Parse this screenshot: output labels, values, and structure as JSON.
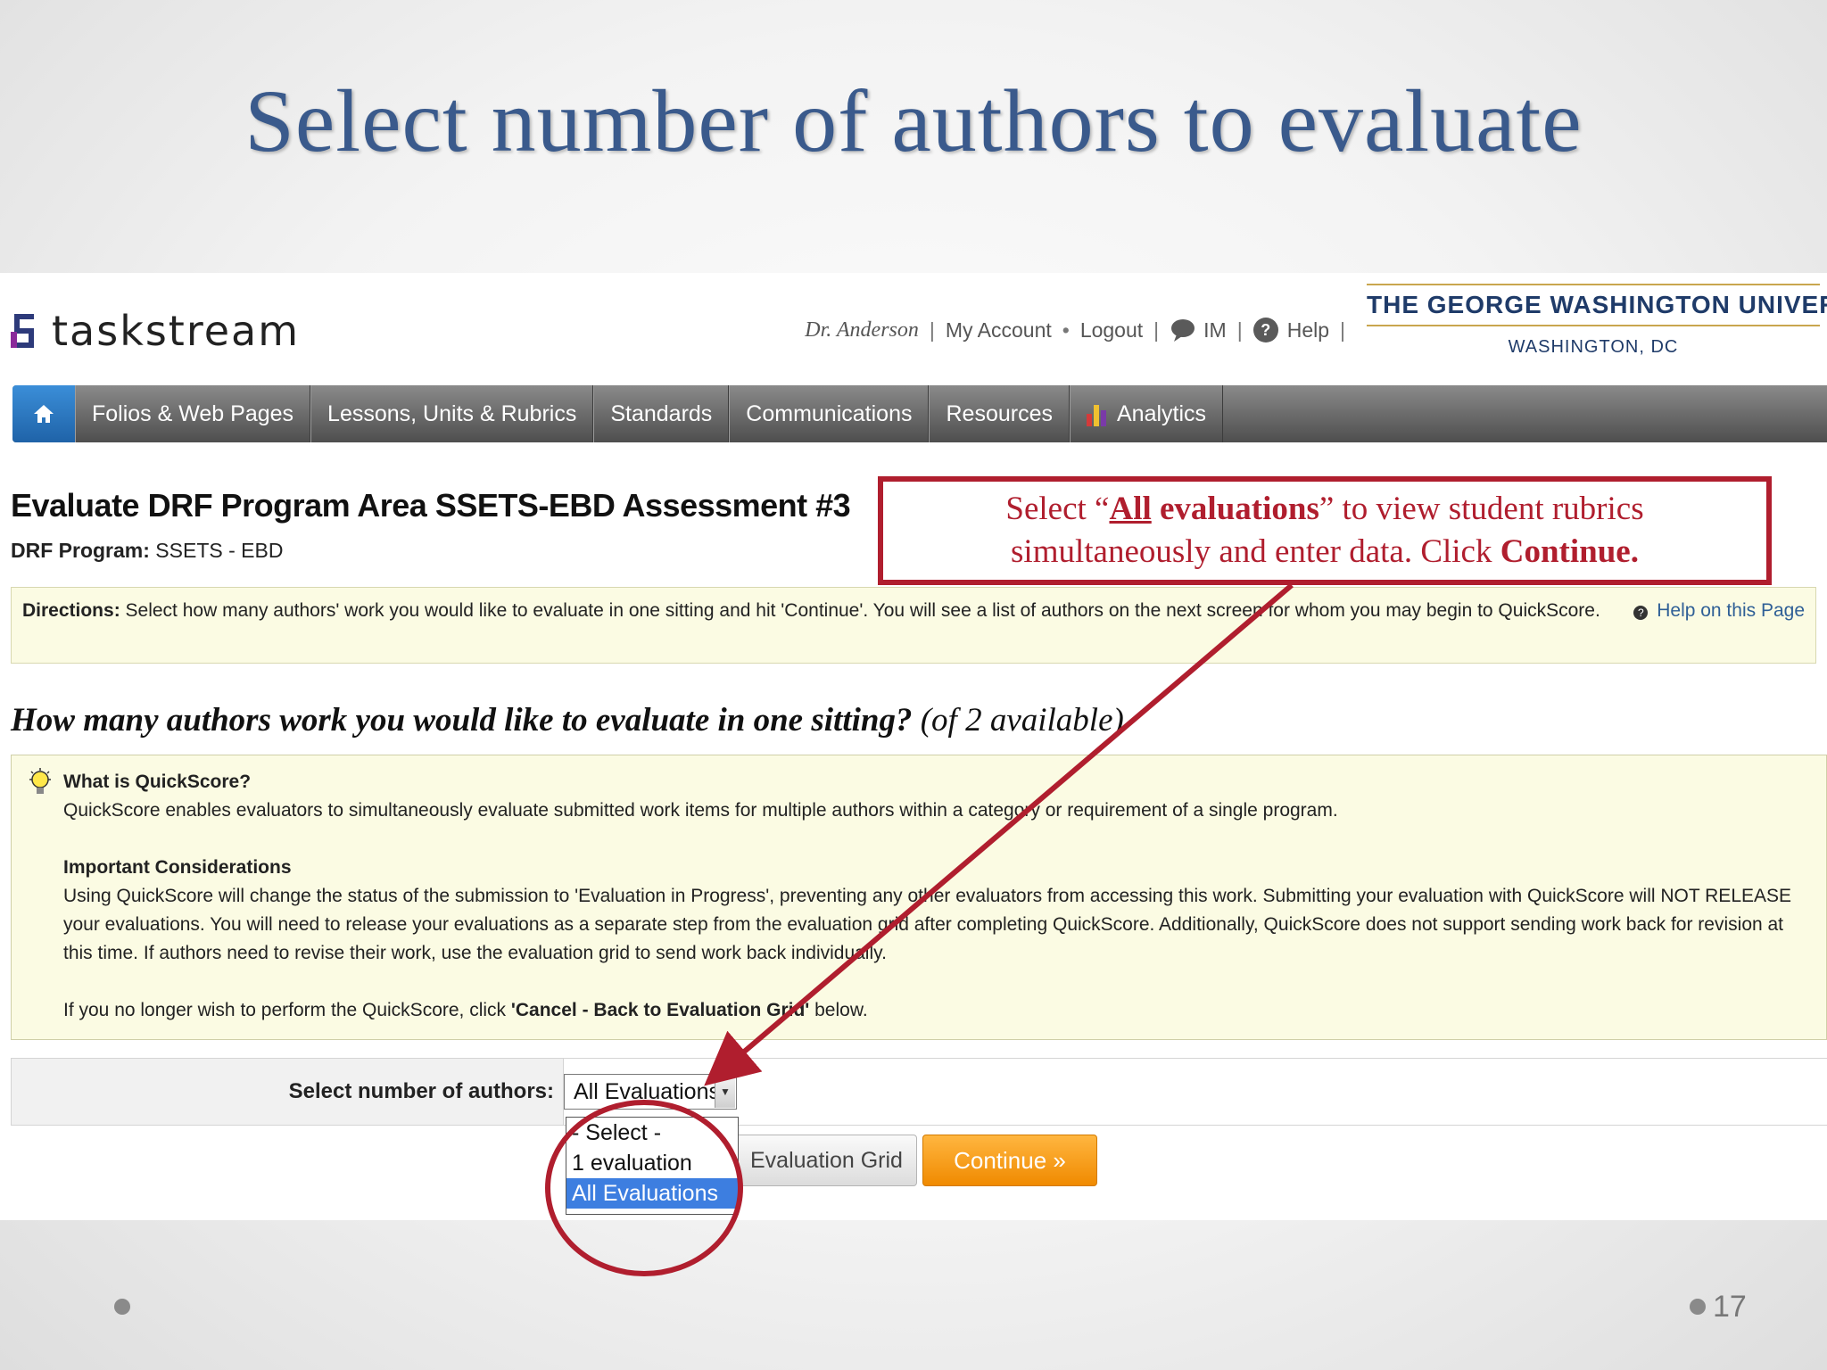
{
  "slide": {
    "title": "Select number of authors to evaluate",
    "page_number": "17"
  },
  "header": {
    "logo_text": "taskstream",
    "user": "Dr. Anderson",
    "links": [
      "My Account",
      "Logout",
      "IM",
      "Help"
    ],
    "university": "THE GEORGE WASHINGTON UNIVERSITY",
    "university_location": "WASHINGTON, DC"
  },
  "nav": {
    "items": [
      "Folios & Web Pages",
      "Lessons, Units & Rubrics",
      "Standards",
      "Communications",
      "Resources",
      "Analytics"
    ]
  },
  "page": {
    "title": "Evaluate DRF Program Area SSETS-EBD Assessment #3",
    "program_label": "DRF Program:",
    "program_value": "SSETS - EBD",
    "directions_label": "Directions:",
    "directions_text": "Select how many authors' work you would like to evaluate in one sitting and hit 'Continue'. You will see a list of authors on the next screen for whom you may begin to QuickScore.",
    "help_link": "Help on this Page",
    "question": "How many authors work you would like to evaluate in one sitting?",
    "question_available": "(of 2 available)"
  },
  "quickscore": {
    "heading": "What is QuickScore?",
    "description": "QuickScore enables evaluators to simultaneously evaluate submitted work items for multiple authors within a category or requirement of a single program.",
    "considerations_heading": "Important Considerations",
    "considerations_text": "Using QuickScore will change the status of the submission to 'Evaluation in Progress', preventing any other evaluators from accessing this work. Submitting your evaluation with QuickScore will NOT RELEASE your evaluations. You will need to release your evaluations as a separate step from the evaluation grid after completing QuickScore. Additionally, QuickScore does not support sending work back for revision at this time. If authors need to revise their work, use the evaluation grid to send work back individually.",
    "cancel_prefix": "If you no longer wish to perform the QuickScore, click ",
    "cancel_bold": "'Cancel - Back to Evaluation Grid'",
    "cancel_suffix": " below."
  },
  "form": {
    "select_label": "Select number of authors:",
    "selected_value": "All Evaluations",
    "options": [
      "- Select -",
      "1 evaluation",
      "All Evaluations"
    ],
    "cancel_button": "Evaluation Grid",
    "continue_button": "Continue »"
  },
  "callout": {
    "part1": "Select “",
    "part2": "All",
    "part3": " evaluations",
    "part4": "” to view student rubrics",
    "line2": "simultaneously and enter data. Click ",
    "line2_bold": "Continue."
  },
  "colors": {
    "title_blue": "#3a5a8c",
    "callout_red": "#b01e2e",
    "nav_home_blue": "#2b78c8",
    "continue_orange": "#f5a020",
    "gwu_navy": "#1f3b69"
  }
}
